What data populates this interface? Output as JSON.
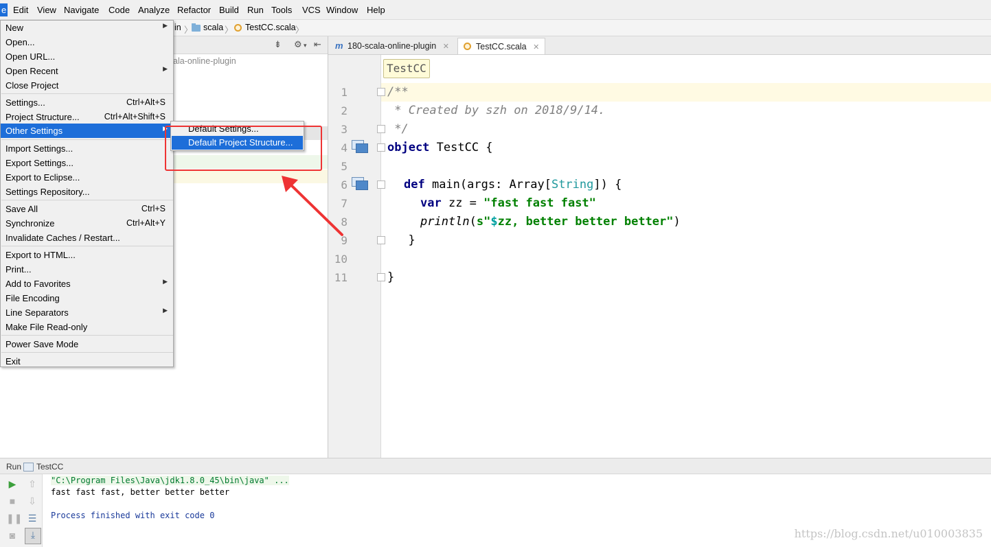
{
  "menubar": {
    "items": [
      "e",
      "Edit",
      "View",
      "Navigate",
      "Code",
      "Analyze",
      "Refactor",
      "Build",
      "Run",
      "Tools",
      "VCS",
      "Window",
      "Help"
    ]
  },
  "breadcrumb": {
    "segments": [
      "in",
      "scala",
      "TestCC.scala"
    ]
  },
  "project": {
    "root_label": "ala-online-plugin"
  },
  "tabs": [
    {
      "label": "180-scala-online-plugin",
      "active": false
    },
    {
      "label": "TestCC.scala",
      "active": true
    }
  ],
  "editor": {
    "hint": "TestCC",
    "line_numbers": [
      "1",
      "2",
      "3",
      "4",
      "5",
      "6",
      "7",
      "8",
      "9",
      "10",
      "11"
    ],
    "code": {
      "l1": "/**",
      "l2": " * Created by szh on 2018/9/14.",
      "l3": " */",
      "l4_kw": "object",
      "l4_rest": " TestCC {",
      "l6_kw": "def",
      "l6_mid": " main(args: Array[",
      "l6_type": "String",
      "l6_end": "]) {",
      "l7_kw": "var",
      "l7_mid": " zz = ",
      "l7_str": "\"fast fast fast\"",
      "l8_fn": "println",
      "l8_open": "(",
      "l8_s": "s\"",
      "l8_dollar": "$",
      "l8_str": "zz, better better better\"",
      "l8_close": ")",
      "l9": "  }",
      "l11": "}"
    }
  },
  "file_menu": {
    "items": [
      {
        "label": "New",
        "shortcut": "",
        "submenu": true
      },
      {
        "label": "Open...",
        "shortcut": "",
        "submenu": false
      },
      {
        "label": "Open URL...",
        "shortcut": "",
        "submenu": false
      },
      {
        "label": "Open Recent",
        "shortcut": "",
        "submenu": true
      },
      {
        "label": "Close Project",
        "shortcut": "",
        "submenu": false
      },
      {
        "label": "Settings...",
        "shortcut": "Ctrl+Alt+S",
        "submenu": false
      },
      {
        "label": "Project Structure...",
        "shortcut": "Ctrl+Alt+Shift+S",
        "submenu": false
      },
      {
        "label": "Other Settings",
        "shortcut": "",
        "submenu": true
      },
      {
        "label": "Import Settings...",
        "shortcut": "",
        "submenu": false
      },
      {
        "label": "Export Settings...",
        "shortcut": "",
        "submenu": false
      },
      {
        "label": "Export to Eclipse...",
        "shortcut": "",
        "submenu": false
      },
      {
        "label": "Settings Repository...",
        "shortcut": "",
        "submenu": false
      },
      {
        "label": "Save All",
        "shortcut": "Ctrl+S",
        "submenu": false
      },
      {
        "label": "Synchronize",
        "shortcut": "Ctrl+Alt+Y",
        "submenu": false
      },
      {
        "label": "Invalidate Caches / Restart...",
        "shortcut": "",
        "submenu": false
      },
      {
        "label": "Export to HTML...",
        "shortcut": "",
        "submenu": false
      },
      {
        "label": "Print...",
        "shortcut": "",
        "submenu": false
      },
      {
        "label": "Add to Favorites",
        "shortcut": "",
        "submenu": true
      },
      {
        "label": "File Encoding",
        "shortcut": "",
        "submenu": false
      },
      {
        "label": "Line Separators",
        "shortcut": "",
        "submenu": true
      },
      {
        "label": "Make File Read-only",
        "shortcut": "",
        "submenu": false
      },
      {
        "label": "Power Save Mode",
        "shortcut": "",
        "submenu": false
      },
      {
        "label": "Exit",
        "shortcut": "",
        "submenu": false
      }
    ]
  },
  "submenu": {
    "items": [
      "Default Settings...",
      "Default Project Structure..."
    ]
  },
  "run_panel": {
    "title": "Run",
    "config": "TestCC",
    "console": [
      "\"C:\\Program Files\\Java\\jdk1.8.0_45\\bin\\java\" ...",
      "fast fast fast, better better better",
      "",
      "Process finished with exit code 0"
    ]
  },
  "watermark": "https://blog.csdn.net/u010003835",
  "colors": {
    "accent": "#1d6ed9",
    "annotation": "#ee3333",
    "keyword": "#000080",
    "string": "#008000",
    "comment": "#808080"
  }
}
